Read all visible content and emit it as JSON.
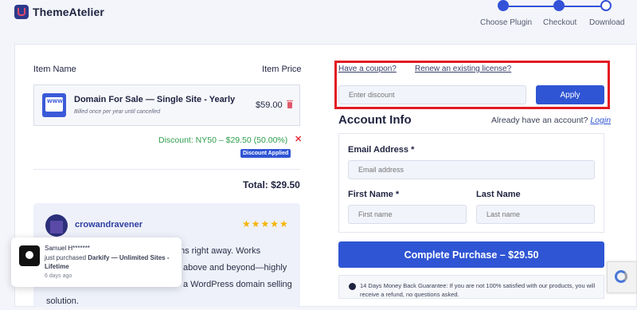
{
  "header": {
    "brand": "ThemeAtelier"
  },
  "steps": [
    {
      "label": "Choose Plugin",
      "state": "done"
    },
    {
      "label": "Checkout",
      "state": "current"
    },
    {
      "label": "Download",
      "state": "pending"
    }
  ],
  "cart": {
    "col_item": "Item Name",
    "col_price": "Item Price",
    "item": {
      "icon_text": "WWW",
      "title": "Domain For Sale — Single Site - Yearly",
      "subtitle": "Billed once per year until cancelled",
      "price": "$59.00"
    },
    "discount_text": "Discount:  NY50 – $29.50 (50.00%)",
    "discount_remove": "✕",
    "discount_badge": "Discount Applied",
    "total": "Total: $29.50"
  },
  "review": {
    "name": "crowandravener",
    "stars": "★★★★★",
    "lines": [
      "ns right away. Works",
      "above and beyond—highly",
      "a WordPress domain selling",
      "solution."
    ]
  },
  "toast": {
    "name": "Samuel H*******",
    "action": "just purchased",
    "product": "Darkify — Unlimited Sites - Lifetime",
    "time": "6 days ago"
  },
  "coupon": {
    "have_coupon": "Have a coupon?",
    "renew": "Renew an existing license?",
    "placeholder": "Enter discount",
    "apply": "Apply"
  },
  "account": {
    "title": "Account Info",
    "question": "Already have an account?",
    "login": "Login",
    "email_label": "Email Address *",
    "email_placeholder": "Email address",
    "first_label": "First Name *",
    "first_placeholder": "First name",
    "last_label": "Last Name",
    "last_placeholder": "Last name"
  },
  "purchase": {
    "label": "Complete Purchase – $29.50"
  },
  "guarantee": {
    "text": "14 Days Money Back Guarantee: If you are not 100% satisfied with our products, you will receive a refund, no questions asked."
  },
  "colors": {
    "accent": "#2f55d4",
    "highlight": "#e31b23",
    "success": "#2d9d4a"
  }
}
